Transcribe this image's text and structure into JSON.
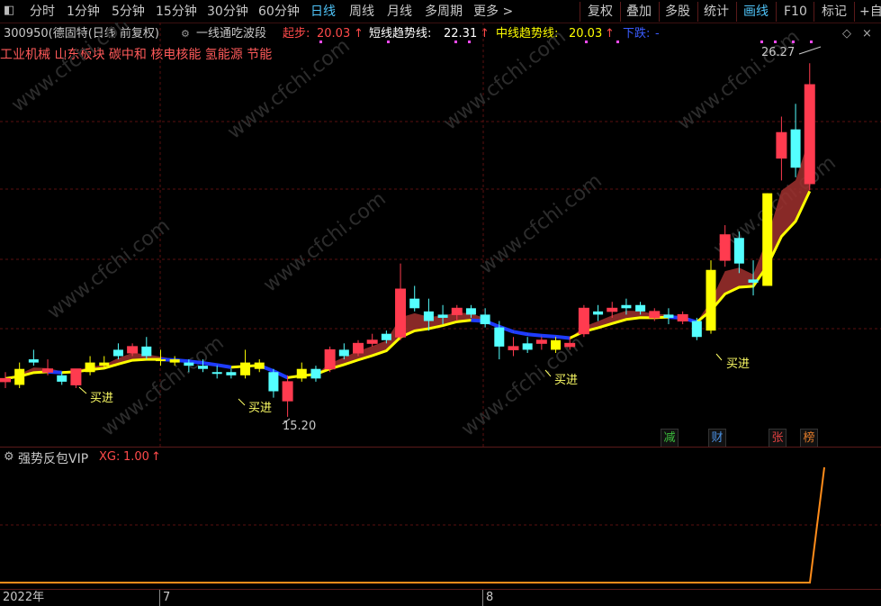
{
  "toolbar": {
    "left_items": [
      "分时",
      "1分钟",
      "5分钟",
      "15分钟",
      "30分钟",
      "60分钟",
      "日线",
      "周线",
      "月线",
      "多周期",
      "更多 >"
    ],
    "active_period": "日线",
    "right_items": [
      "复权",
      "叠加",
      "多股",
      "统计",
      "画线",
      "F10",
      "标记",
      "+自"
    ],
    "active_right": "画线"
  },
  "infobar": {
    "stock": "300950(德固特(日线 前复权)",
    "indicator_name": "一线通吃波段",
    "qibu_label": "起步:",
    "qibu_value": "20.03",
    "short_label": "短线趋势线:",
    "short_value": "22.31",
    "mid_label": "中线趋势线:",
    "mid_value": "20.03",
    "down_label": "下跌:",
    "down_value": "-",
    "arrow": "↑"
  },
  "tags": "工业机械 山东板块 碳中和 核电核能 氢能源 节能",
  "annotations": {
    "high_price": "26.27",
    "low_price": "15.20",
    "buy_label": "买进"
  },
  "badges": [
    {
      "text": "减",
      "color": "#3cbf3c"
    },
    {
      "text": "财",
      "color": "#4a90e2"
    },
    {
      "text": "张",
      "color": "#e04040"
    },
    {
      "text": "榜",
      "color": "#e07a2a"
    }
  ],
  "lower_panel": {
    "title": "强势反包VIP",
    "xg_label": "XG:",
    "xg_value": "1.00",
    "arrow": "↑"
  },
  "dates": [
    "2022年",
    "7",
    "8"
  ],
  "watermark": "www.cfchi.com",
  "colors": {
    "up": "#ff3b4f",
    "down": "#54ffff",
    "yellow": "#ffff00",
    "band": "#a0302e",
    "blue": "#1e3cff",
    "accent": "#4fc3f7"
  },
  "chart_data": {
    "type": "candlestick",
    "candles": [
      {
        "o": 16.3,
        "h": 16.6,
        "l": 16.1,
        "c": 16.4,
        "k": "up"
      },
      {
        "o": 16.2,
        "h": 16.9,
        "l": 16.1,
        "c": 16.7,
        "k": "hold"
      },
      {
        "o": 16.9,
        "h": 17.3,
        "l": 16.8,
        "c": 17.0,
        "k": "down"
      },
      {
        "o": 16.6,
        "h": 17.0,
        "l": 16.5,
        "c": 16.7,
        "k": "up"
      },
      {
        "o": 16.3,
        "h": 16.6,
        "l": 16.2,
        "c": 16.5,
        "k": "down"
      },
      {
        "o": 16.2,
        "h": 16.6,
        "l": 16.1,
        "c": 16.7,
        "k": "up"
      },
      {
        "o": 16.6,
        "h": 17.1,
        "l": 16.5,
        "c": 16.9,
        "k": "hold"
      },
      {
        "o": 16.8,
        "h": 17.1,
        "l": 16.7,
        "c": 16.9,
        "k": "hold"
      },
      {
        "o": 17.1,
        "h": 17.5,
        "l": 17.0,
        "c": 17.3,
        "k": "down"
      },
      {
        "o": 17.2,
        "h": 17.5,
        "l": 17.1,
        "c": 17.4,
        "k": "up"
      },
      {
        "o": 17.4,
        "h": 17.7,
        "l": 17.0,
        "c": 17.1,
        "k": "down"
      },
      {
        "o": 17.0,
        "h": 17.3,
        "l": 16.8,
        "c": 17.0,
        "k": "hold"
      },
      {
        "o": 17.0,
        "h": 17.1,
        "l": 16.8,
        "c": 16.9,
        "k": "hold"
      },
      {
        "o": 16.9,
        "h": 17.0,
        "l": 16.6,
        "c": 16.8,
        "k": "down"
      },
      {
        "o": 16.8,
        "h": 17.0,
        "l": 16.6,
        "c": 16.7,
        "k": "down"
      },
      {
        "o": 16.6,
        "h": 16.8,
        "l": 16.4,
        "c": 16.6,
        "k": "down"
      },
      {
        "o": 16.6,
        "h": 16.7,
        "l": 16.4,
        "c": 16.5,
        "k": "down"
      },
      {
        "o": 16.5,
        "h": 17.3,
        "l": 16.4,
        "c": 16.9,
        "k": "hold"
      },
      {
        "o": 16.7,
        "h": 17.0,
        "l": 16.6,
        "c": 16.9,
        "k": "hold"
      },
      {
        "o": 16.6,
        "h": 16.7,
        "l": 15.8,
        "c": 16.0,
        "k": "down"
      },
      {
        "o": 16.3,
        "h": 16.5,
        "l": 15.2,
        "c": 15.7,
        "k": "up"
      },
      {
        "o": 16.4,
        "h": 16.9,
        "l": 16.3,
        "c": 16.7,
        "k": "hold"
      },
      {
        "o": 16.4,
        "h": 16.8,
        "l": 16.3,
        "c": 16.7,
        "k": "down"
      },
      {
        "o": 16.7,
        "h": 17.4,
        "l": 16.6,
        "c": 17.3,
        "k": "up"
      },
      {
        "o": 17.1,
        "h": 17.5,
        "l": 17.0,
        "c": 17.3,
        "k": "down"
      },
      {
        "o": 17.2,
        "h": 17.6,
        "l": 17.1,
        "c": 17.5,
        "k": "up"
      },
      {
        "o": 17.5,
        "h": 17.8,
        "l": 17.4,
        "c": 17.6,
        "k": "up"
      },
      {
        "o": 17.6,
        "h": 17.9,
        "l": 17.5,
        "c": 17.8,
        "k": "down"
      },
      {
        "o": 17.7,
        "h": 20.0,
        "l": 17.6,
        "c": 19.2,
        "k": "up"
      },
      {
        "o": 18.9,
        "h": 19.3,
        "l": 18.5,
        "c": 18.6,
        "k": "down"
      },
      {
        "o": 18.5,
        "h": 18.9,
        "l": 17.9,
        "c": 18.2,
        "k": "down"
      },
      {
        "o": 18.3,
        "h": 18.7,
        "l": 18.1,
        "c": 18.4,
        "k": "down"
      },
      {
        "o": 18.4,
        "h": 18.7,
        "l": 18.2,
        "c": 18.6,
        "k": "up"
      },
      {
        "o": 18.6,
        "h": 18.7,
        "l": 18.3,
        "c": 18.4,
        "k": "down"
      },
      {
        "o": 18.4,
        "h": 18.6,
        "l": 18.0,
        "c": 18.1,
        "k": "down"
      },
      {
        "o": 18.0,
        "h": 18.2,
        "l": 17.0,
        "c": 17.4,
        "k": "down"
      },
      {
        "o": 17.4,
        "h": 17.7,
        "l": 17.1,
        "c": 17.3,
        "k": "up"
      },
      {
        "o": 17.3,
        "h": 17.7,
        "l": 17.2,
        "c": 17.5,
        "k": "down"
      },
      {
        "o": 17.5,
        "h": 17.7,
        "l": 17.3,
        "c": 17.6,
        "k": "up"
      },
      {
        "o": 17.3,
        "h": 17.7,
        "l": 17.2,
        "c": 17.6,
        "k": "hold"
      },
      {
        "o": 17.4,
        "h": 17.7,
        "l": 17.3,
        "c": 17.5,
        "k": "up"
      },
      {
        "o": 17.8,
        "h": 18.7,
        "l": 17.7,
        "c": 18.6,
        "k": "up"
      },
      {
        "o": 18.5,
        "h": 18.7,
        "l": 18.2,
        "c": 18.4,
        "k": "down"
      },
      {
        "o": 18.5,
        "h": 18.8,
        "l": 18.3,
        "c": 18.6,
        "k": "up"
      },
      {
        "o": 18.6,
        "h": 18.9,
        "l": 18.4,
        "c": 18.7,
        "k": "down"
      },
      {
        "o": 18.7,
        "h": 18.8,
        "l": 18.4,
        "c": 18.5,
        "k": "down"
      },
      {
        "o": 18.5,
        "h": 18.6,
        "l": 18.2,
        "c": 18.3,
        "k": "up"
      },
      {
        "o": 18.3,
        "h": 18.6,
        "l": 18.1,
        "c": 18.4,
        "k": "down"
      },
      {
        "o": 18.4,
        "h": 18.5,
        "l": 18.1,
        "c": 18.2,
        "k": "up"
      },
      {
        "o": 18.2,
        "h": 18.3,
        "l": 17.6,
        "c": 17.7,
        "k": "down"
      },
      {
        "o": 17.9,
        "h": 20.1,
        "l": 17.8,
        "c": 19.8,
        "k": "hold"
      },
      {
        "o": 20.1,
        "h": 21.2,
        "l": 19.9,
        "c": 20.9,
        "k": "up"
      },
      {
        "o": 20.8,
        "h": 21.0,
        "l": 19.7,
        "c": 20.0,
        "k": "down"
      },
      {
        "o": 19.5,
        "h": 20.1,
        "l": 19.0,
        "c": 19.4,
        "k": "down"
      },
      {
        "o": 19.3,
        "h": 22.2,
        "l": 19.3,
        "c": 22.2,
        "k": "hold"
      },
      {
        "o": 23.3,
        "h": 24.6,
        "l": 22.6,
        "c": 24.1,
        "k": "up"
      },
      {
        "o": 24.2,
        "h": 25.0,
        "l": 22.7,
        "c": 23.0,
        "k": "down"
      },
      {
        "o": 22.5,
        "h": 26.27,
        "l": 22.3,
        "c": 25.6,
        "k": "up"
      }
    ],
    "ylim": [
      15.0,
      26.7
    ],
    "qibu_value": 20.03,
    "short_trend_value": 22.31,
    "mid_trend_value": 20.03,
    "xg_value": 1.0
  }
}
